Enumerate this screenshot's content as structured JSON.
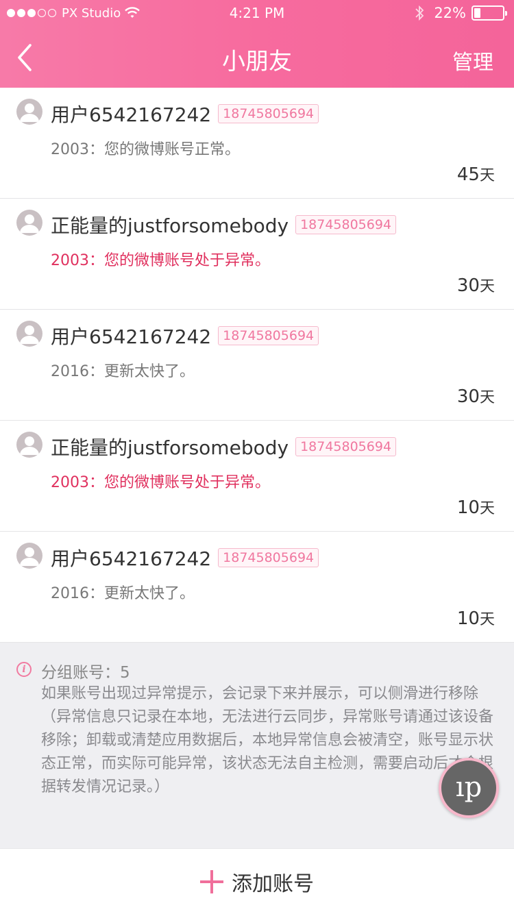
{
  "status_bar": {
    "signal_dots": [
      true,
      true,
      true,
      false,
      false
    ],
    "carrier": "PX Studio",
    "time": "4:21 PM",
    "battery_percent": "22%",
    "battery_level": 0.22
  },
  "nav": {
    "title": "小朋友",
    "manage_label": "管理"
  },
  "accounts": [
    {
      "name": "用户6542167242",
      "phone": "18745805694",
      "message": "2003：您的微博账号正常。",
      "status": "normal",
      "days": "45",
      "days_unit": "天"
    },
    {
      "name": "正能量的justforsomebody",
      "phone": "18745805694",
      "message": "2003：您的微博账号处于异常。",
      "status": "error",
      "days": "30",
      "days_unit": "天"
    },
    {
      "name": "用户6542167242",
      "phone": "18745805694",
      "message": "2016：更新太快了。",
      "status": "normal",
      "days": "30",
      "days_unit": "天"
    },
    {
      "name": "正能量的justforsomebody",
      "phone": "18745805694",
      "message": "2003：您的微博账号处于异常。",
      "status": "error",
      "days": "10",
      "days_unit": "天"
    },
    {
      "name": "用户6542167242",
      "phone": "18745805694",
      "message": "2016：更新太快了。",
      "status": "normal",
      "days": "10",
      "days_unit": "天"
    }
  ],
  "info": {
    "title": "分组账号：5",
    "description": "如果账号出现过异常提示，会记录下来并展示，可以侧滑进行移除（异常信息只记录在本地，无法进行云同步，异常账号请通过该设备移除；卸载或清楚应用数据后，本地异常信息会被清空，账号显示状态正常，而实际可能异常，该状态无法自主检测，需要启动后才会根据转发情况记录。）"
  },
  "float_button": {
    "label": "ıp"
  },
  "add_button": {
    "label": "添加账号"
  },
  "colors": {
    "header_start": "#f77aa8",
    "header_end": "#f4649a",
    "error_text": "#e0305e",
    "accent": "#f06f9b"
  }
}
